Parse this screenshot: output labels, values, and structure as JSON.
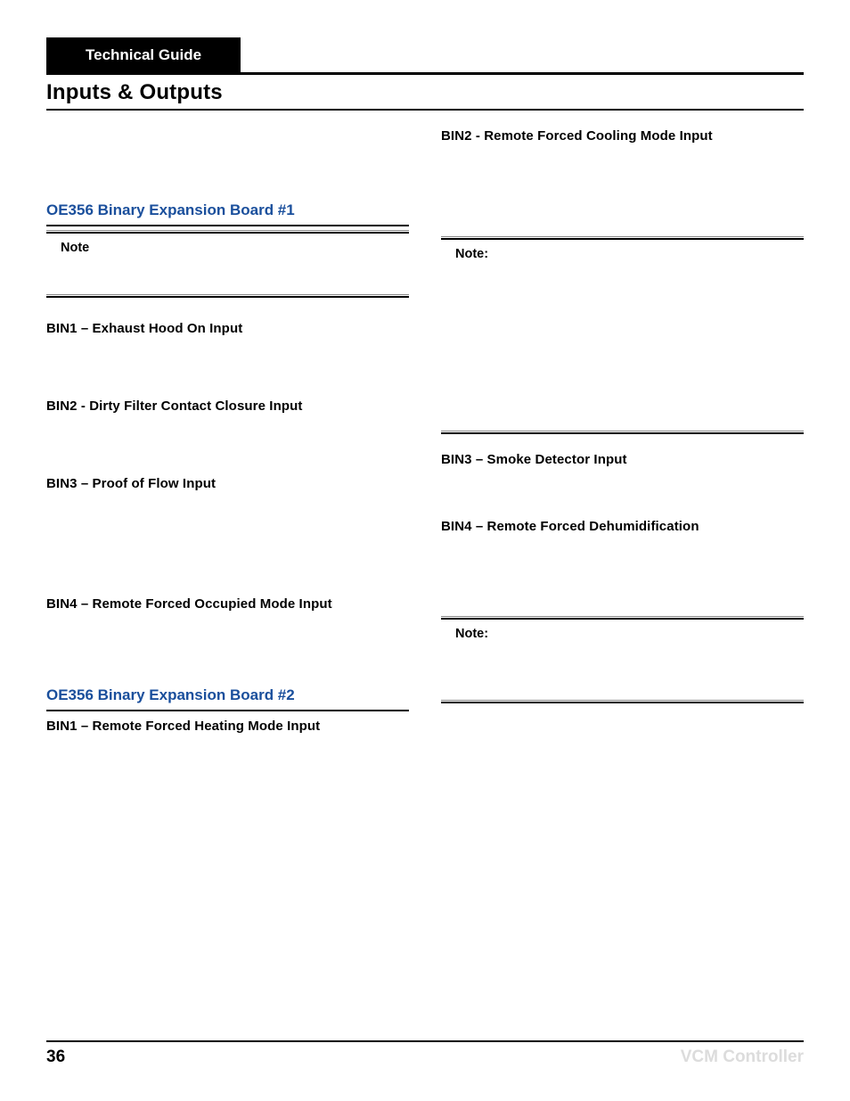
{
  "header": {
    "tab": "Technical Guide",
    "section": "Inputs & Outputs"
  },
  "left": {
    "subsection1": "OE356 Binary Expansion Board #1",
    "note1": "Note",
    "bin1": "BIN1 – Exhaust Hood On Input",
    "bin2": "BIN2 - Dirty Filter Contact Closure Input",
    "bin3": "BIN3 – Proof of Flow Input",
    "bin4": "BIN4 – Remote Forced Occupied Mode Input",
    "subsection2": "OE356 Binary Expansion Board #2",
    "bin1b": "BIN1 – Remote Forced Heating Mode Input"
  },
  "right": {
    "bin2": "BIN2 - Remote Forced Cooling Mode Input",
    "note1": "Note:",
    "bin3": "BIN3 – Smoke Detector Input",
    "bin4": "BIN4 – Remote Forced Dehumidification",
    "note2": "Note:"
  },
  "footer": {
    "page": "36",
    "right": "VCM Controller"
  }
}
